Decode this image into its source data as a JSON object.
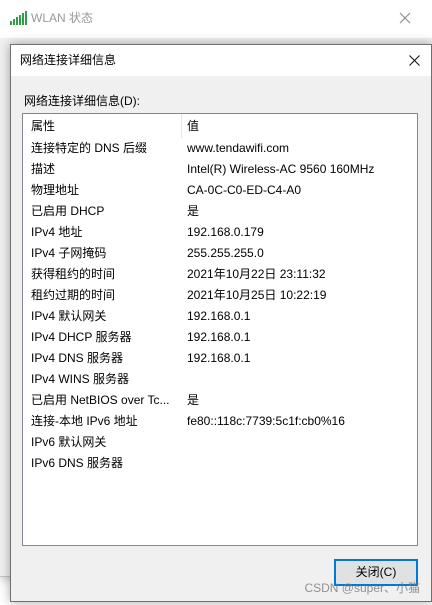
{
  "background_window": {
    "title": "WLAN 状态",
    "icon": "wifi-signal-icon",
    "close_icon": "close-icon"
  },
  "dialog": {
    "title": "网络连接详细信息",
    "close_icon": "close-icon",
    "list_label": "网络连接详细信息(D):",
    "columns": [
      "属性",
      "值"
    ],
    "rows": [
      {
        "property": "连接特定的 DNS 后缀",
        "value": "www.tendawifi.com"
      },
      {
        "property": "描述",
        "value": "Intel(R) Wireless-AC 9560 160MHz"
      },
      {
        "property": "物理地址",
        "value": "CA-0C-C0-ED-C4-A0"
      },
      {
        "property": "已启用 DHCP",
        "value": "是"
      },
      {
        "property": "IPv4 地址",
        "value": "192.168.0.179"
      },
      {
        "property": "IPv4 子网掩码",
        "value": "255.255.255.0"
      },
      {
        "property": "获得租约的时间",
        "value": "2021年10月22日 23:11:32"
      },
      {
        "property": "租约过期的时间",
        "value": "2021年10月25日 10:22:19"
      },
      {
        "property": "IPv4 默认网关",
        "value": "192.168.0.1"
      },
      {
        "property": "IPv4 DHCP 服务器",
        "value": "192.168.0.1"
      },
      {
        "property": "IPv4 DNS 服务器",
        "value": "192.168.0.1"
      },
      {
        "property": "IPv4 WINS 服务器",
        "value": ""
      },
      {
        "property": "已启用 NetBIOS over Tc...",
        "value": "是"
      },
      {
        "property": "连接-本地 IPv6 地址",
        "value": "fe80::118c:7739:5c1f:cb0%16"
      },
      {
        "property": "IPv6 默认网关",
        "value": ""
      },
      {
        "property": "IPv6 DNS 服务器",
        "value": ""
      }
    ],
    "close_button": "关闭(C)"
  },
  "watermark": "CSDN @super、小猫",
  "colors": {
    "accent": "#0078d7",
    "wifi_icon": "#2f9e44",
    "dialog_background": "#f0f0f0",
    "list_background": "#ffffff"
  }
}
